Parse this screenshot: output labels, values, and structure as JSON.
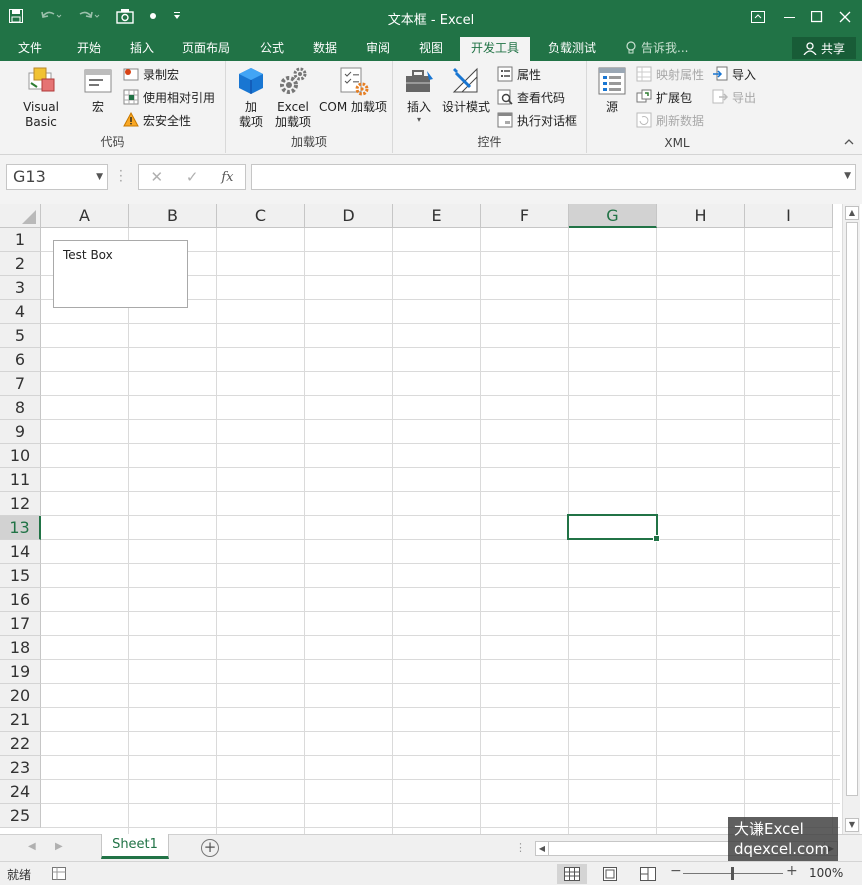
{
  "window": {
    "title": "文本框 - Excel"
  },
  "tabs": [
    "文件",
    "开始",
    "插入",
    "页面布局",
    "公式",
    "数据",
    "审阅",
    "视图",
    "开发工具",
    "负载测试"
  ],
  "tell_me": "告诉我...",
  "share": "共享",
  "ribbon": {
    "code": {
      "label": "代码",
      "visual_basic": "Visual Basic",
      "macros": "宏",
      "record_macro": "录制宏",
      "relative_refs": "使用相对引用",
      "macro_security": "宏安全性"
    },
    "addins": {
      "label": "加载项",
      "addins_line1": "加",
      "addins_line2": "载项",
      "excel_addins_line1": "Excel",
      "excel_addins_line2": "加载项",
      "com_addins": "COM 加载项"
    },
    "controls": {
      "label": "控件",
      "insert": "插入",
      "design_mode": "设计模式",
      "properties": "属性",
      "view_code": "查看代码",
      "run_dialog": "执行对话框"
    },
    "xml": {
      "label": "XML",
      "source": "源",
      "map_properties": "映射属性",
      "expansion_packs": "扩展包",
      "refresh_data": "刷新数据",
      "import": "导入",
      "export": "导出"
    }
  },
  "formula_bar": {
    "name_box": "G13",
    "fx": "fx",
    "formula": ""
  },
  "grid": {
    "columns": [
      "A",
      "B",
      "C",
      "D",
      "E",
      "F",
      "G",
      "H",
      "I"
    ],
    "rows": [
      "1",
      "2",
      "3",
      "4",
      "5",
      "6",
      "7",
      "8",
      "9",
      "10",
      "11",
      "12",
      "13",
      "14",
      "15",
      "16",
      "17",
      "18",
      "19",
      "20",
      "21",
      "22",
      "23",
      "24",
      "25"
    ],
    "selected_column": "G",
    "selected_row": "13",
    "text_box": "Test Box"
  },
  "sheets": [
    "Sheet1"
  ],
  "status": {
    "ready": "就绪",
    "zoom": "100%"
  },
  "watermark": {
    "line1": "大谦Excel",
    "line2": "dqexcel.com"
  },
  "colors": {
    "accent": "#217346",
    "accent_dark": "#185c37"
  }
}
